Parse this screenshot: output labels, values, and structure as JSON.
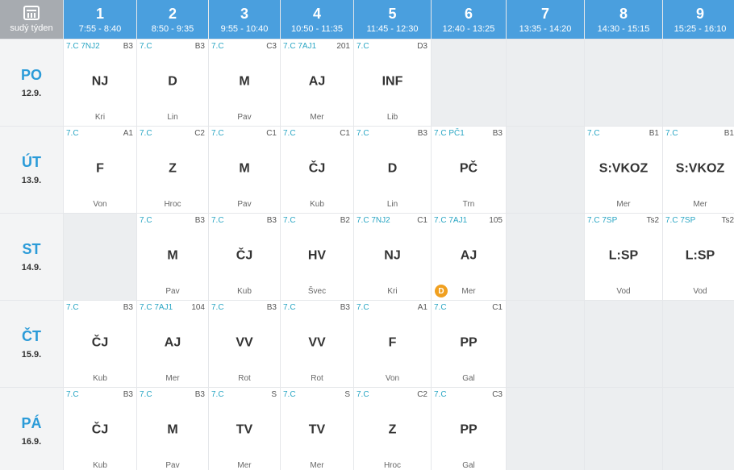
{
  "header": {
    "week_label": "sudý týden",
    "periods": [
      {
        "num": "1",
        "time": "7:55 - 8:40"
      },
      {
        "num": "2",
        "time": "8:50 - 9:35"
      },
      {
        "num": "3",
        "time": "9:55 - 10:40"
      },
      {
        "num": "4",
        "time": "10:50 - 11:35"
      },
      {
        "num": "5",
        "time": "11:45 - 12:30"
      },
      {
        "num": "6",
        "time": "12:40 - 13:25"
      },
      {
        "num": "7",
        "time": "13:35 - 14:20"
      },
      {
        "num": "8",
        "time": "14:30 - 15:15"
      },
      {
        "num": "9",
        "time": "15:25 - 16:10"
      }
    ]
  },
  "days": [
    {
      "abbr": "PO",
      "date": "12.9.",
      "lessons": [
        {
          "cls": "7.C 7NJ2",
          "room": "B3",
          "subject": "NJ",
          "teacher": "Kri"
        },
        {
          "cls": "7.C",
          "room": "B3",
          "subject": "D",
          "teacher": "Lin"
        },
        {
          "cls": "7.C",
          "room": "C3",
          "subject": "M",
          "teacher": "Pav"
        },
        {
          "cls": "7.C 7AJ1",
          "room": "201",
          "subject": "AJ",
          "teacher": "Mer"
        },
        {
          "cls": "7.C",
          "room": "D3",
          "subject": "INF",
          "teacher": "Lib"
        },
        null,
        null,
        null,
        null
      ]
    },
    {
      "abbr": "ÚT",
      "date": "13.9.",
      "lessons": [
        {
          "cls": "7.C",
          "room": "A1",
          "subject": "F",
          "teacher": "Von"
        },
        {
          "cls": "7.C",
          "room": "C2",
          "subject": "Z",
          "teacher": "Hroc"
        },
        {
          "cls": "7.C",
          "room": "C1",
          "subject": "M",
          "teacher": "Pav"
        },
        {
          "cls": "7.C",
          "room": "C1",
          "subject": "ČJ",
          "teacher": "Kub"
        },
        {
          "cls": "7.C",
          "room": "B3",
          "subject": "D",
          "teacher": "Lin"
        },
        {
          "cls": "7.C PČ1",
          "room": "B3",
          "subject": "PČ",
          "teacher": "Trn"
        },
        null,
        {
          "cls": "7.C",
          "room": "B1",
          "subject": "S:VKOZ",
          "teacher": "Mer"
        },
        {
          "cls": "7.C",
          "room": "B1",
          "subject": "S:VKOZ",
          "teacher": "Mer"
        }
      ]
    },
    {
      "abbr": "ST",
      "date": "14.9.",
      "lessons": [
        null,
        {
          "cls": "7.C",
          "room": "B3",
          "subject": "M",
          "teacher": "Pav"
        },
        {
          "cls": "7.C",
          "room": "B3",
          "subject": "ČJ",
          "teacher": "Kub"
        },
        {
          "cls": "7.C",
          "room": "B2",
          "subject": "HV",
          "teacher": "Švec"
        },
        {
          "cls": "7.C 7NJ2",
          "room": "C1",
          "subject": "NJ",
          "teacher": "Kri"
        },
        {
          "cls": "7.C 7AJ1",
          "room": "105",
          "subject": "AJ",
          "teacher": "Mer",
          "badge": "D"
        },
        null,
        {
          "cls": "7.C 7SP",
          "room": "Ts2",
          "subject": "L:SP",
          "teacher": "Vod"
        },
        {
          "cls": "7.C 7SP",
          "room": "Ts2",
          "subject": "L:SP",
          "teacher": "Vod"
        }
      ]
    },
    {
      "abbr": "ČT",
      "date": "15.9.",
      "lessons": [
        {
          "cls": "7.C",
          "room": "B3",
          "subject": "ČJ",
          "teacher": "Kub"
        },
        {
          "cls": "7.C 7AJ1",
          "room": "104",
          "subject": "AJ",
          "teacher": "Mer"
        },
        {
          "cls": "7.C",
          "room": "B3",
          "subject": "VV",
          "teacher": "Rot"
        },
        {
          "cls": "7.C",
          "room": "B3",
          "subject": "VV",
          "teacher": "Rot"
        },
        {
          "cls": "7.C",
          "room": "A1",
          "subject": "F",
          "teacher": "Von"
        },
        {
          "cls": "7.C",
          "room": "C1",
          "subject": "PP",
          "teacher": "Gal"
        },
        null,
        null,
        null
      ]
    },
    {
      "abbr": "PÁ",
      "date": "16.9.",
      "lessons": [
        {
          "cls": "7.C",
          "room": "B3",
          "subject": "ČJ",
          "teacher": "Kub"
        },
        {
          "cls": "7.C",
          "room": "B3",
          "subject": "M",
          "teacher": "Pav"
        },
        {
          "cls": "7.C",
          "room": "S",
          "subject": "TV",
          "teacher": "Mer"
        },
        {
          "cls": "7.C",
          "room": "S",
          "subject": "TV",
          "teacher": "Mer"
        },
        {
          "cls": "7.C",
          "room": "C2",
          "subject": "Z",
          "teacher": "Hroc"
        },
        {
          "cls": "7.C",
          "room": "C3",
          "subject": "PP",
          "teacher": "Gal"
        },
        null,
        null,
        null
      ]
    }
  ],
  "colors": {
    "header_blue": "#4a9fde",
    "day_blue": "#2b9bd8",
    "class_cyan": "#2aa6c4",
    "badge_orange": "#f0a020"
  }
}
